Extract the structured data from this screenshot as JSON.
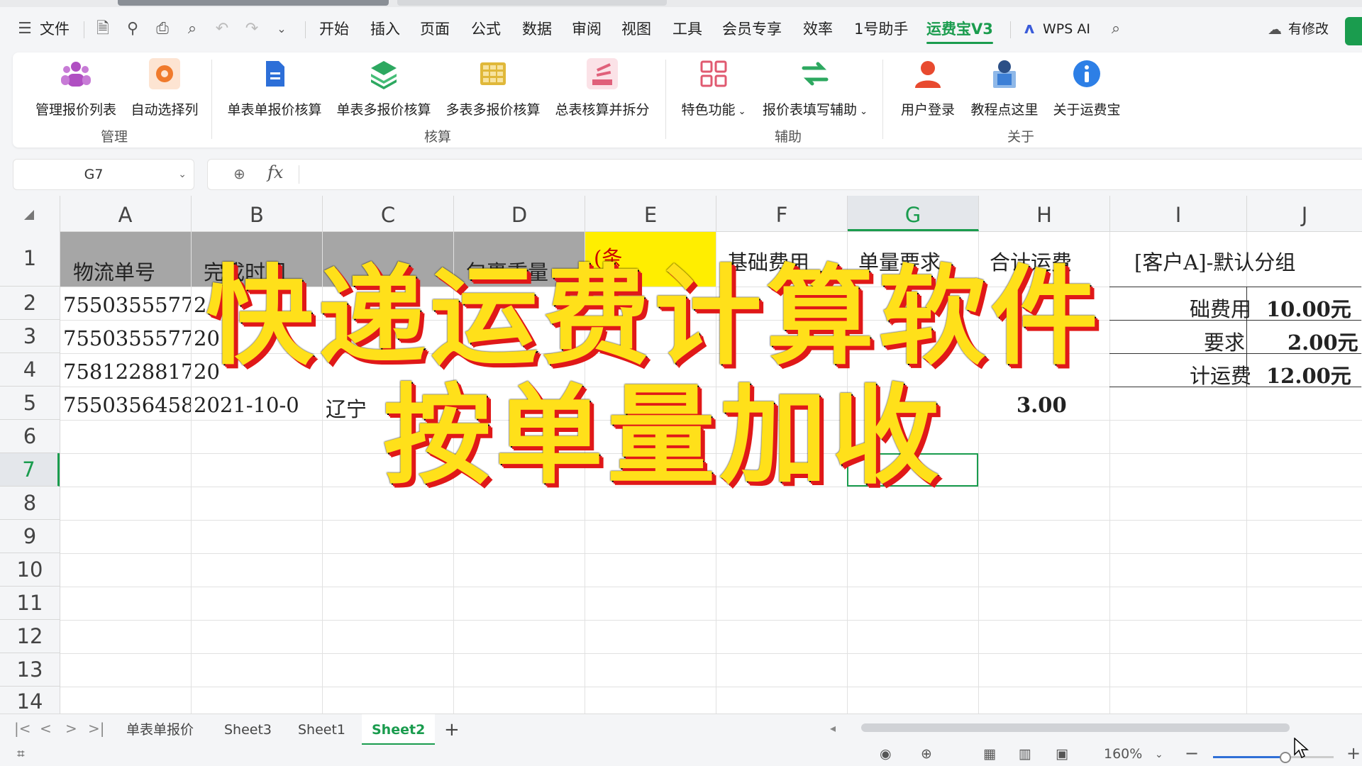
{
  "menubar": {
    "file_label": "文件",
    "tabs": [
      "开始",
      "插入",
      "页面",
      "公式",
      "数据",
      "审阅",
      "视图",
      "工具",
      "会员专享",
      "效率",
      "1号助手",
      "运费宝V3"
    ],
    "active_tab": "运费宝V3",
    "wps_ai": "WPS AI",
    "modified": "有修改"
  },
  "ribbon": {
    "buttons": [
      {
        "label": "管理报价列表",
        "icon": "people-icon",
        "color": "#b04fc2"
      },
      {
        "label": "自动选择列",
        "icon": "auto-select-icon",
        "color": "#f07a2c"
      },
      {
        "label": "单表单报价核算",
        "icon": "document-icon",
        "color": "#2d6fd8"
      },
      {
        "label": "单表多报价核算",
        "icon": "layers-icon",
        "color": "#2da860"
      },
      {
        "label": "多表多报价核算",
        "icon": "grid-icon",
        "color": "#e0b83a"
      },
      {
        "label": "总表核算并拆分",
        "icon": "split-icon",
        "color": "#e0607a"
      },
      {
        "label": "特色功能",
        "icon": "apps-icon",
        "color": "#e05a70"
      },
      {
        "label": "报价表填写辅助",
        "icon": "exchange-icon",
        "color": "#2da860"
      },
      {
        "label": "用户登录",
        "icon": "user-icon",
        "color": "#e84a2f"
      },
      {
        "label": "教程点这里",
        "icon": "tutorial-icon",
        "color": "#3c7fd6"
      },
      {
        "label": "关于运费宝",
        "icon": "info-icon",
        "color": "#2d7fe6"
      }
    ],
    "groups": [
      "管理",
      "核算",
      "辅助",
      "关于"
    ]
  },
  "formula_bar": {
    "cell_ref": "G7",
    "fx": "fx",
    "content": ""
  },
  "grid": {
    "columns": [
      "A",
      "B",
      "C",
      "D",
      "E",
      "F",
      "G",
      "H",
      "I",
      "J"
    ],
    "selected_column": "G",
    "rows": [
      "1",
      "2",
      "3",
      "4",
      "5",
      "6",
      "7",
      "8",
      "9",
      "10",
      "11",
      "12",
      "13",
      "14"
    ],
    "selected_row": "7",
    "header_row": [
      "物流单号",
      "完成时间",
      "",
      "包裹重量",
      "(条",
      "基础费用",
      "单量要求",
      "合计运费"
    ],
    "side_table_title": "[客户A]-默认分组",
    "side_table": [
      {
        "label": "础费用",
        "value": "10.00元"
      },
      {
        "label": "要求",
        "value": "2.00元"
      },
      {
        "label": "计运费",
        "value": "12.00元"
      }
    ],
    "a_col": [
      "7550355577",
      "7550355577",
      "7581228817",
      "7550356458"
    ],
    "b_col": [
      "2",
      "20",
      "20",
      "2021-10-0"
    ],
    "c5": "辽宁",
    "h5": "3.00"
  },
  "overlay": {
    "line1": "快递运费计算软件",
    "line2": "按单量加收"
  },
  "sheet_tabs": {
    "tabs": [
      "单表单报价",
      "Sheet3",
      "Sheet1",
      "Sheet2"
    ],
    "active": "Sheet2",
    "add": "+"
  },
  "statusbar": {
    "zoom": "160%"
  }
}
